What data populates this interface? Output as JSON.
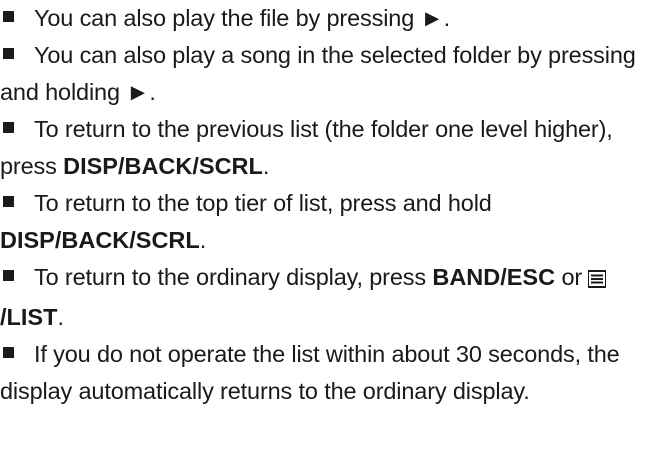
{
  "items": [
    {
      "text": "You can also play the file by pressing ►."
    },
    {
      "text": "You can also play a song in the selected folder by pressing and holding ►."
    },
    {
      "text_before": "To return to the previous list (the folder one level higher), press ",
      "key": "DISP/BACK/SCRL",
      "text_after": "."
    },
    {
      "text_before": "To return to the top tier of list, press and hold ",
      "key": "DISP/BACK/SCRL",
      "text_after": "."
    },
    {
      "text_before": "To return to the ordinary display, press ",
      "key1": "BAND/ESC",
      "or": " or ",
      "slash": "/",
      "key2": "LIST",
      "text_after": ".",
      "icon": "list-icon"
    },
    {
      "text": "If you do not operate the list within about 30 seconds, the display automatically returns to the ordinary display."
    }
  ]
}
